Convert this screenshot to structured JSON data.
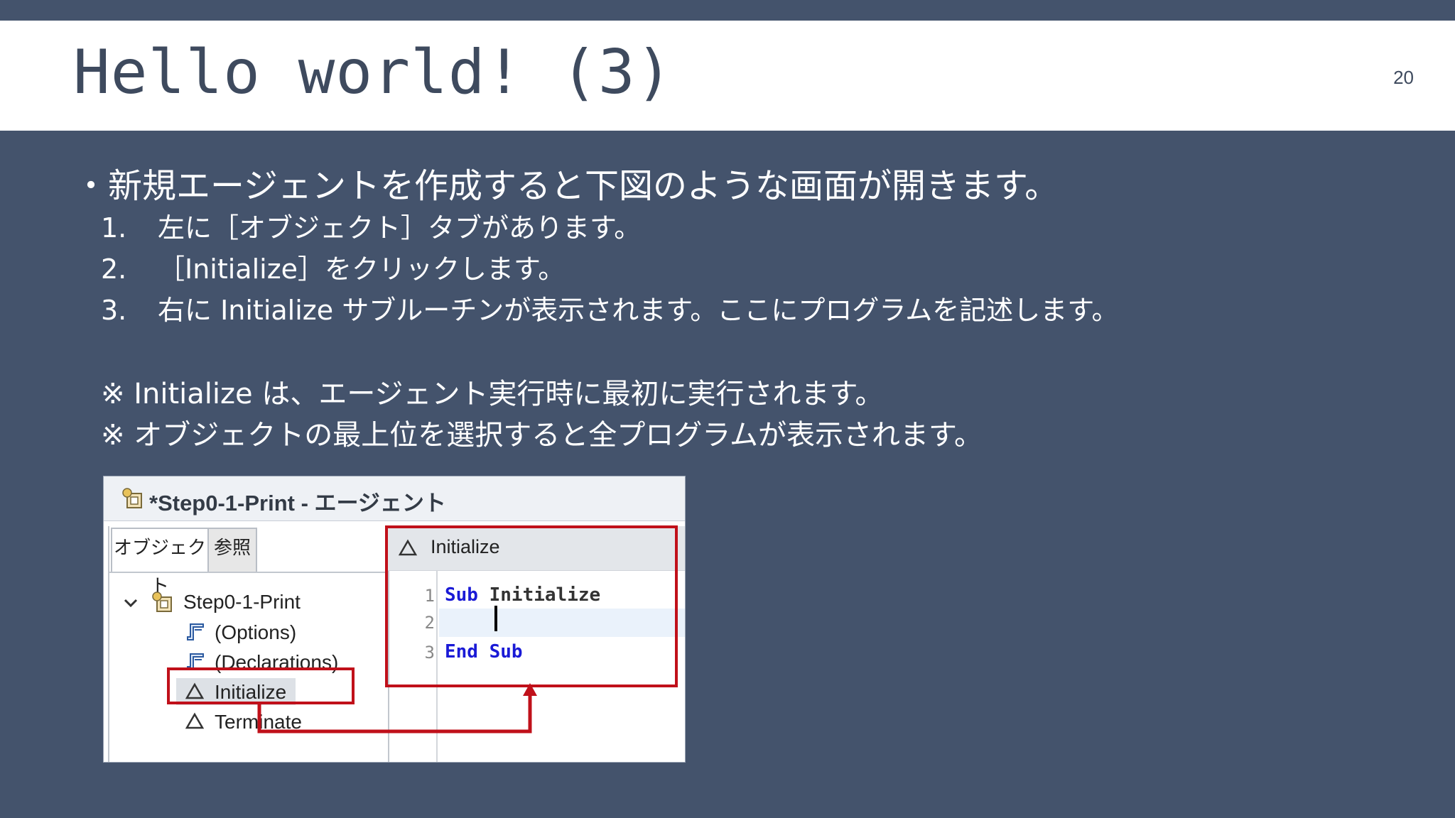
{
  "slide": {
    "title": "Hello world! (3)",
    "page_number": "20"
  },
  "body": {
    "bullet": "・新規エージェントを作成すると下図のような画面が開きます。",
    "steps": [
      {
        "num": "1.",
        "text": "左に［オブジェクト］タブがあります。"
      },
      {
        "num": "2.",
        "text": "［Initialize］をクリックします。"
      },
      {
        "num": "3.",
        "text": "右に Initialize サブルーチンが表示されます。ここにプログラムを記述します。"
      }
    ],
    "notes": [
      "※ Initialize は、エージェント実行時に最初に実行されます。",
      "※ オブジェクトの最上位を選択すると全プログラムが表示されます。"
    ]
  },
  "ide": {
    "window_title": "*Step0-1-Print - エージェント",
    "tabs": [
      "オブジェクト",
      "参照"
    ],
    "tree": {
      "root": "Step0-1-Print",
      "items": [
        "(Options)",
        "(Declarations)",
        "Initialize",
        "Terminate"
      ],
      "selected": "Initialize"
    },
    "editor": {
      "header": "Initialize",
      "lines": [
        {
          "n": "1",
          "kw1": "Sub",
          "rest": " Initialize"
        },
        {
          "n": "2",
          "kw1": "",
          "rest": ""
        },
        {
          "n": "3",
          "kw1": "End",
          "rest": "Sub"
        }
      ]
    },
    "icons": [
      "agent-icon",
      "chevron-down-icon",
      "script-icon",
      "triangle-icon"
    ],
    "highlight_color": "#c0101a"
  }
}
